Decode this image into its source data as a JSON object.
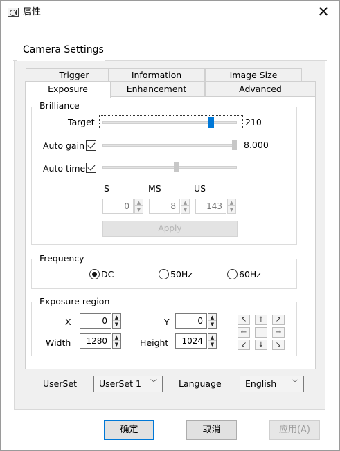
{
  "window": {
    "title": "属性",
    "close_glyph": "✕",
    "title_icon": "camera-icon"
  },
  "outer_tab": {
    "label": "Camera Settings"
  },
  "inner_tabs": {
    "row1": [
      "Trigger",
      "Information",
      "Image Size"
    ],
    "row2": [
      "Exposure",
      "Enhancement",
      "Advanced"
    ],
    "active": "Exposure"
  },
  "brilliance": {
    "title": "Brilliance",
    "target_label": "Target",
    "target_value": "210",
    "auto_gain_label": "Auto gain",
    "auto_gain_checked": true,
    "auto_gain_value": "8.000",
    "auto_time_label": "Auto time",
    "auto_time_checked": true,
    "units": [
      "S",
      "MS",
      "US"
    ],
    "s_value": "0",
    "ms_value": "8",
    "us_value": "143",
    "apply_label": "Apply",
    "target_level": 0.82,
    "gain_level": 1.0,
    "time_level": 0.55
  },
  "frequency": {
    "title": "Frequency",
    "options": [
      "DC",
      "50Hz",
      "60Hz"
    ],
    "selected": "DC"
  },
  "exposure_region": {
    "title": "Exposure region",
    "x_label": "X",
    "x_value": "0",
    "y_label": "Y",
    "y_value": "0",
    "width_label": "Width",
    "width_value": "1280",
    "height_label": "Height",
    "height_value": "1024",
    "arrows": [
      "↖",
      "↑",
      "↗",
      "←",
      "",
      "→",
      "↙",
      "↓",
      "↘"
    ]
  },
  "userset": {
    "label": "UserSet",
    "value": "UserSet 1"
  },
  "language": {
    "label": "Language",
    "value": "English"
  },
  "buttons": {
    "ok": "确定",
    "cancel": "取消",
    "apply": "应用(A)"
  },
  "colors": {
    "accent": "#0078d7",
    "slider_thumb": "#0078d7",
    "slider_track": "#e3e3e3"
  }
}
